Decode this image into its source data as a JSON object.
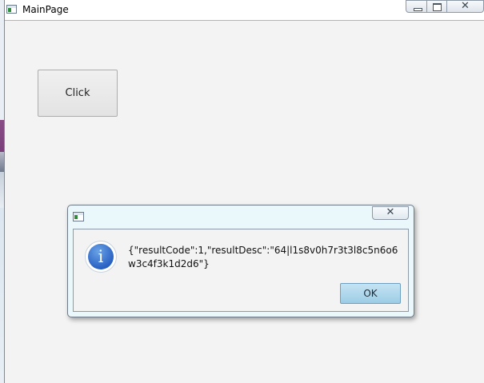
{
  "window": {
    "title": "MainPage",
    "icon": "app-window-icon",
    "close_glyph": "✕"
  },
  "main": {
    "click_button_label": "Click"
  },
  "dialog": {
    "icon": "info-icon",
    "info_glyph": "i",
    "message": "{\"resultCode\":1,\"resultDesc\":\"64|l1s8v0h7r3t3l8c5n6o6w3c4f3k1d2d6\"}",
    "ok_label": "OK",
    "close_glyph": "✕"
  }
}
